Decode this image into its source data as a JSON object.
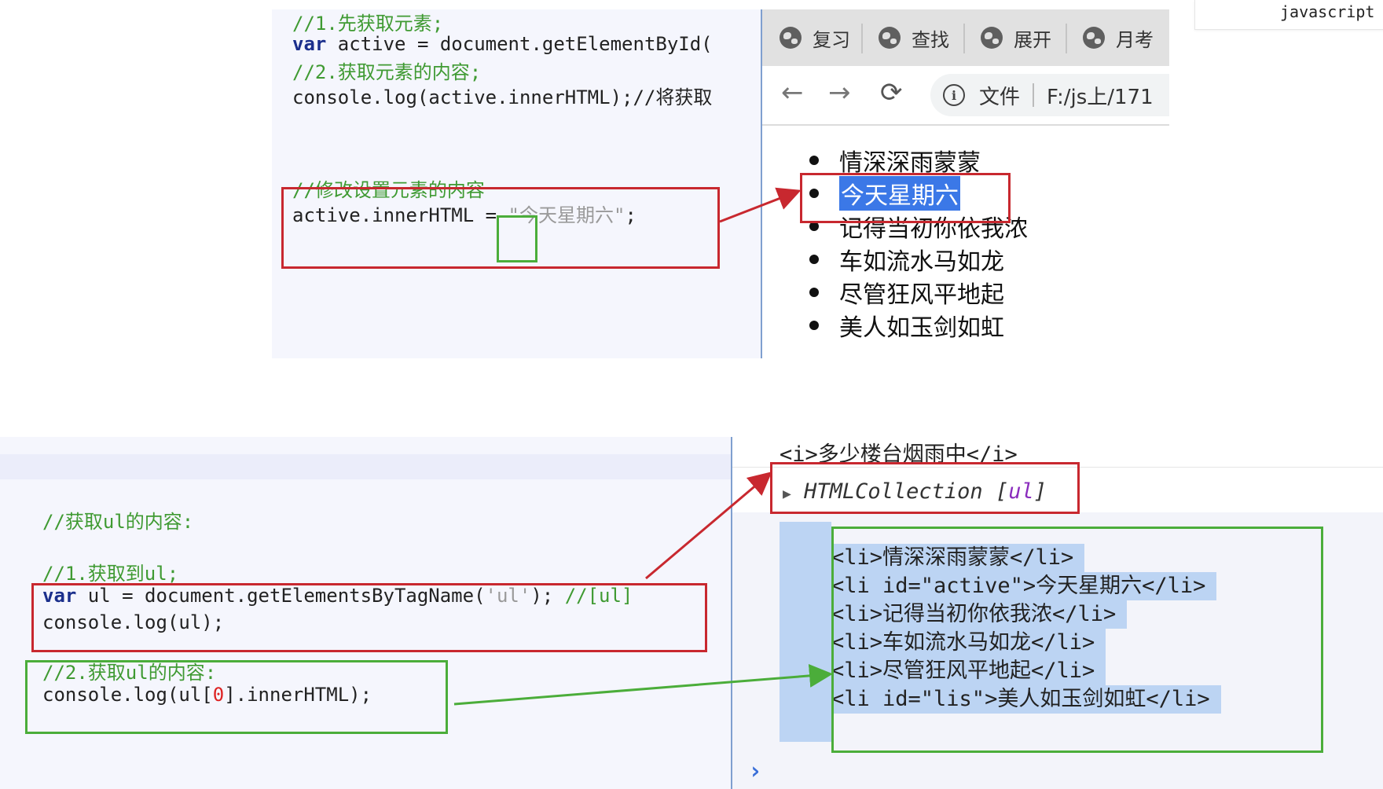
{
  "top_code": {
    "line1": "//1.先获取元素;",
    "line2_kw": "var",
    "line2_rest": " active = document.getElementById(",
    "line3": "//2.获取元素的内容;",
    "line4": "console.log(active.innerHTML);//将获取",
    "line5": "//修改设置元素的内容",
    "line6_a": "active.innerHTML ",
    "line6_eq": "=",
    "line6_str": " \"今天星期六\"",
    "line6_end": ";"
  },
  "browser": {
    "tabs": [
      "复习",
      "查找",
      "展开",
      "月考"
    ],
    "nav_back": "←",
    "nav_forward": "→",
    "nav_reload": "⟳",
    "info_icon_glyph": "i",
    "addr_file_label": "文件",
    "addr_path": "F:/js上/171",
    "list_items": [
      "情深深雨蒙蒙",
      "今天星期六",
      "记得当初你依我浓",
      "车如流水马如龙",
      "尽管狂风平地起",
      "美人如玉剑如虹"
    ]
  },
  "js_tag": "javascript",
  "bottom_code": {
    "line1": "//获取ul的内容:",
    "line2": "//1.获取到ul;",
    "line3_kw": "var",
    "line3_a": " ul = document.getElementsByTagName(",
    "line3_str": "'ul'",
    "line3_b": "); ",
    "line3_cmt": "//[ul]",
    "line4": "console.log(ul);",
    "line5": "//2.获取ul的内容:",
    "line6_a": "console.log(ul[",
    "line6_num": "0",
    "line6_b": "].innerHTML);"
  },
  "console": {
    "top_line": "<i>多少楼台烟雨中</i>",
    "collection_prefix": "HTMLCollection [",
    "collection_item": "ul",
    "collection_suffix": "]",
    "html_lines": [
      "<li>情深深雨蒙蒙</li>",
      "<li id=\"active\">今天星期六</li>",
      "<li>记得当初你依我浓</li>",
      "<li>车如流水马如龙</li>",
      "<li>尽管狂风平地起</li>",
      "<li id=\"lis\">美人如玉剑如虹</li>"
    ],
    "prompt": "›"
  }
}
